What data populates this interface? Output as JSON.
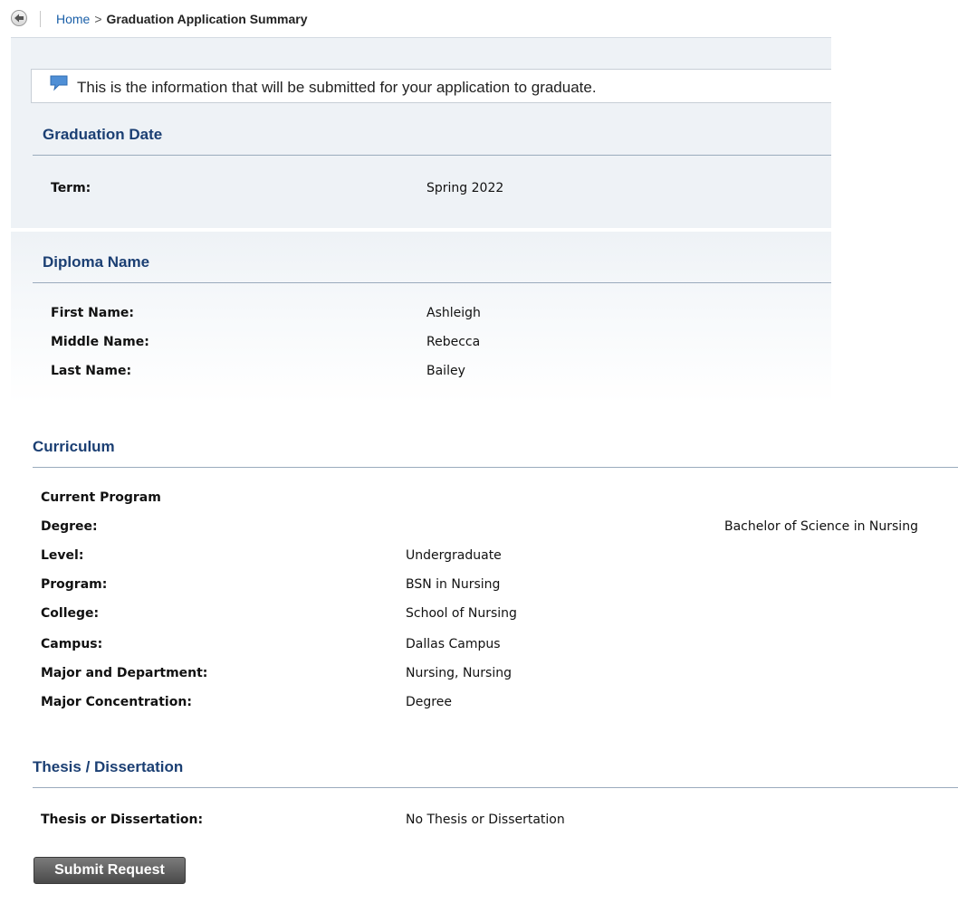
{
  "nav": {
    "back_icon": "back-arrow-icon",
    "breadcrumb": {
      "home": "Home",
      "separator": ">",
      "current": "Graduation Application Summary"
    }
  },
  "info": {
    "icon": "comment-icon",
    "message": "This is the information that will be submitted for your application to graduate."
  },
  "graduation_date": {
    "title": "Graduation Date",
    "term_label": "Term:",
    "term_value": "Spring 2022"
  },
  "diploma_name": {
    "title": "Diploma Name",
    "first_label": "First Name:",
    "first_value": "Ashleigh",
    "middle_label": "Middle Name:",
    "middle_value": "Rebecca",
    "last_label": "Last Name:",
    "last_value": "Bailey"
  },
  "curriculum": {
    "title": "Curriculum",
    "current_program": "Current Program",
    "rows": [
      {
        "label": "Degree:",
        "value": "Bachelor of Science in Nursing"
      },
      {
        "label": "Level:",
        "value": "Undergraduate"
      },
      {
        "label": "Program:",
        "value": "BSN in Nursing"
      },
      {
        "label": "College:",
        "value": "School of Nursing"
      },
      {
        "label": "Campus:",
        "value": "Dallas Campus"
      },
      {
        "label": "Major and Department:",
        "value": "Nursing, Nursing"
      },
      {
        "label": "Major Concentration:",
        "value": "Degree"
      }
    ]
  },
  "thesis": {
    "title": "Thesis / Dissertation",
    "label": "Thesis or Dissertation:",
    "value": "No Thesis or Dissertation"
  },
  "actions": {
    "submit_label": "Submit Request"
  },
  "colors": {
    "link": "#1a5fa8",
    "section_title": "#1b3f73",
    "panel_bg": "#eef2f6",
    "info_icon": "#4f8fd6"
  }
}
